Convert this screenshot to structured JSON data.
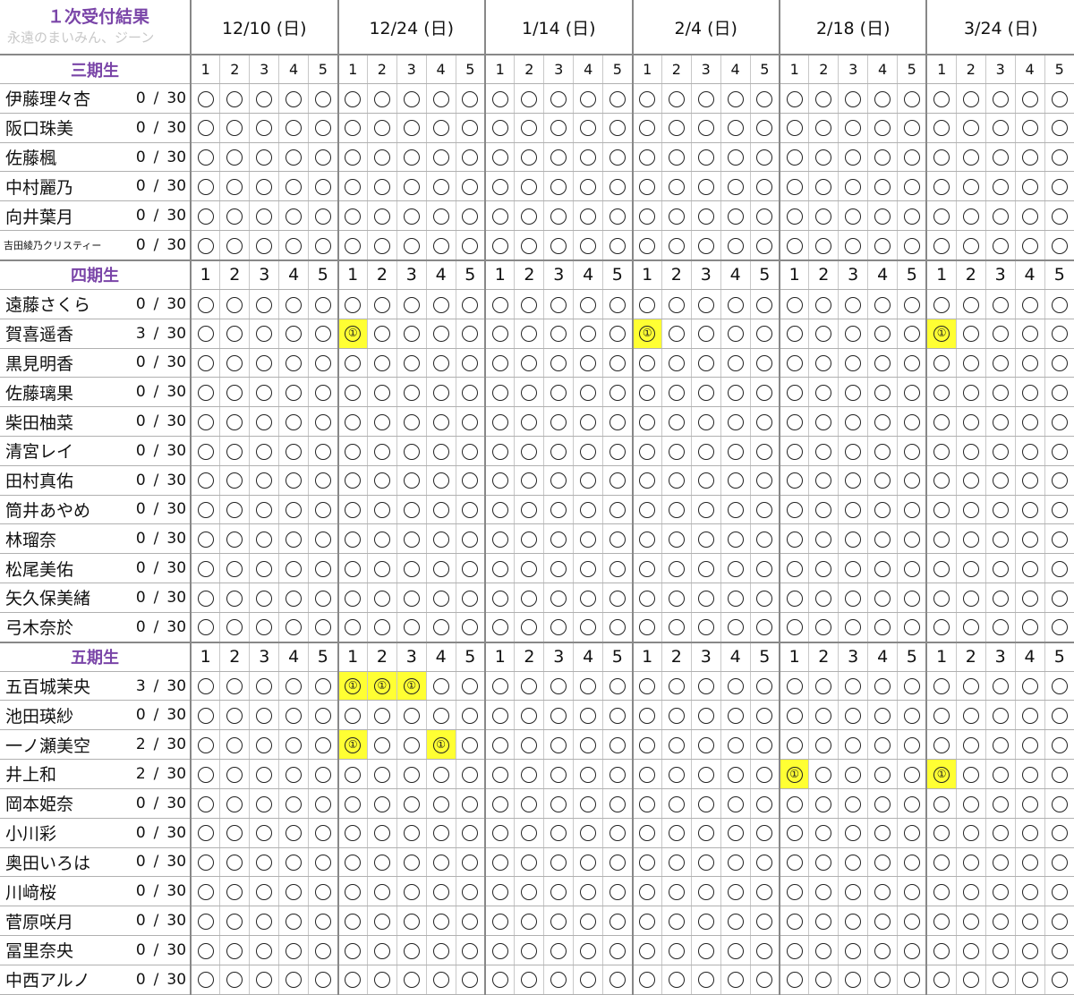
{
  "title": "１次受付結果",
  "subtitle": "永遠のまいみん、ジーン",
  "dates": [
    "12/10 (日)",
    "12/24 (日)",
    "1/14 (日)",
    "2/4 (日)",
    "2/18 (日)",
    "3/24 (日)"
  ],
  "slot_numbers": [
    "1",
    "2",
    "3",
    "4",
    "5"
  ],
  "hit_mark": "①",
  "sep": "/",
  "total": "30",
  "generations": [
    {
      "label": "三期生",
      "members": [
        {
          "name": "伊藤理々杏",
          "count": "0",
          "hits": []
        },
        {
          "name": "阪口珠美",
          "count": "0",
          "hits": []
        },
        {
          "name": "佐藤楓",
          "count": "0",
          "hits": []
        },
        {
          "name": "中村麗乃",
          "count": "0",
          "hits": []
        },
        {
          "name": "向井葉月",
          "count": "0",
          "hits": []
        },
        {
          "name": "吉田綾乃クリスティー",
          "count": "0",
          "hits": [],
          "small": true
        }
      ]
    },
    {
      "label": "四期生",
      "members": [
        {
          "name": "遠藤さくら",
          "count": "0",
          "hits": []
        },
        {
          "name": "賀喜遥香",
          "count": "3",
          "hits": [
            5,
            15,
            25
          ]
        },
        {
          "name": "黒見明香",
          "count": "0",
          "hits": []
        },
        {
          "name": "佐藤璃果",
          "count": "0",
          "hits": []
        },
        {
          "name": "柴田柚菜",
          "count": "0",
          "hits": []
        },
        {
          "name": "清宮レイ",
          "count": "0",
          "hits": []
        },
        {
          "name": "田村真佑",
          "count": "0",
          "hits": []
        },
        {
          "name": "筒井あやめ",
          "count": "0",
          "hits": []
        },
        {
          "name": "林瑠奈",
          "count": "0",
          "hits": []
        },
        {
          "name": "松尾美佑",
          "count": "0",
          "hits": []
        },
        {
          "name": "矢久保美緒",
          "count": "0",
          "hits": []
        },
        {
          "name": "弓木奈於",
          "count": "0",
          "hits": []
        }
      ]
    },
    {
      "label": "五期生",
      "members": [
        {
          "name": "五百城茉央",
          "count": "3",
          "hits": [
            5,
            6,
            7
          ]
        },
        {
          "name": "池田瑛紗",
          "count": "0",
          "hits": []
        },
        {
          "name": "一ノ瀬美空",
          "count": "2",
          "hits": [
            5,
            8
          ]
        },
        {
          "name": "井上和",
          "count": "2",
          "hits": [
            20,
            25
          ]
        },
        {
          "name": "岡本姫奈",
          "count": "0",
          "hits": []
        },
        {
          "name": "小川彩",
          "count": "0",
          "hits": []
        },
        {
          "name": "奥田いろは",
          "count": "0",
          "hits": []
        },
        {
          "name": "川﨑桜",
          "count": "0",
          "hits": []
        },
        {
          "name": "菅原咲月",
          "count": "0",
          "hits": []
        },
        {
          "name": "冨里奈央",
          "count": "0",
          "hits": []
        },
        {
          "name": "中西アルノ",
          "count": "0",
          "hits": []
        }
      ]
    }
  ]
}
